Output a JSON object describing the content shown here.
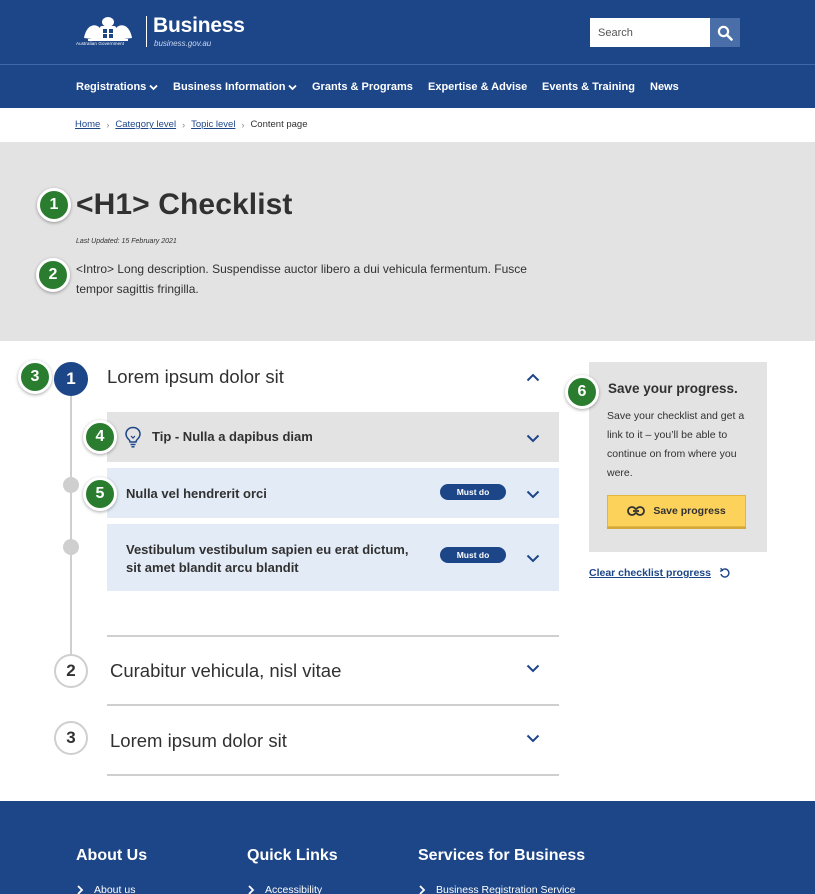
{
  "header": {
    "gov_caption": "Australian Government",
    "brand_name": "Business",
    "brand_url": "business.gov.au",
    "search_placeholder": "Search",
    "search_icon": "search-icon"
  },
  "nav": {
    "items": [
      {
        "label": "Registrations",
        "has_dropdown": true
      },
      {
        "label": "Business Information",
        "has_dropdown": true
      },
      {
        "label": "Grants & Programs",
        "has_dropdown": false
      },
      {
        "label": "Expertise & Advise",
        "has_dropdown": false
      },
      {
        "label": "Events & Training",
        "has_dropdown": false
      },
      {
        "label": "News",
        "has_dropdown": false
      }
    ]
  },
  "breadcrumb": {
    "items": [
      "Home",
      "Category level",
      "Topic level"
    ],
    "current": "Content page"
  },
  "hero": {
    "title": "<H1> Checklist",
    "updated": "Last Updated: 15 February 2021",
    "intro": "<Intro> Long description. Suspendisse auctor libero a dui vehicula fermentum. Fusce tempor sagittis fringilla."
  },
  "markers": [
    "1",
    "2",
    "3",
    "4",
    "5",
    "6"
  ],
  "steps": [
    {
      "number": "1",
      "title": "Lorem ipsum dolor sit",
      "expanded": true,
      "tip": "Tip - Nulla a dapibus diam",
      "tasks": [
        {
          "text": "Nulla vel hendrerit orci",
          "badge": "Must do"
        },
        {
          "text": "Vestibulum vestibulum sapien eu erat dictum, sit amet blandit arcu blandit",
          "badge": "Must do"
        }
      ]
    },
    {
      "number": "2",
      "title": "Curabitur vehicula, nisl vitae",
      "expanded": false
    },
    {
      "number": "3",
      "title": "Lorem ipsum dolor sit",
      "expanded": false
    }
  ],
  "sidebar": {
    "title": "Save your progress.",
    "description": "Save your checklist and get a link to it – you’ll be able to continue on from where you were.",
    "button_label": "Save progress",
    "clear_label": "Clear checklist progress"
  },
  "footer": {
    "columns": [
      {
        "heading": "About Us",
        "first_link": "About us"
      },
      {
        "heading": "Quick Links",
        "first_link": "Accessibility"
      },
      {
        "heading": "Services for Business",
        "first_link": "Business Registration Service"
      }
    ]
  },
  "colors": {
    "brand_blue": "#1d4688",
    "marker_green": "#2a7d2e",
    "save_yellow": "#fcd25b",
    "hero_grey": "#e3e3e3",
    "task_blue": "#e3ebf6"
  }
}
